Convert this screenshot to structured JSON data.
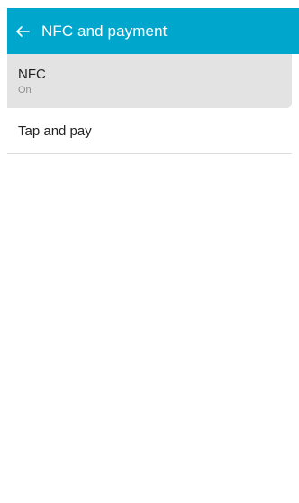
{
  "header": {
    "title": "NFC and payment",
    "back_icon": "arrow-left-icon",
    "accent_color": "#00a6cc"
  },
  "settings": {
    "items": [
      {
        "title": "NFC",
        "subtitle": "On"
      },
      {
        "title": "Tap and pay"
      }
    ]
  }
}
